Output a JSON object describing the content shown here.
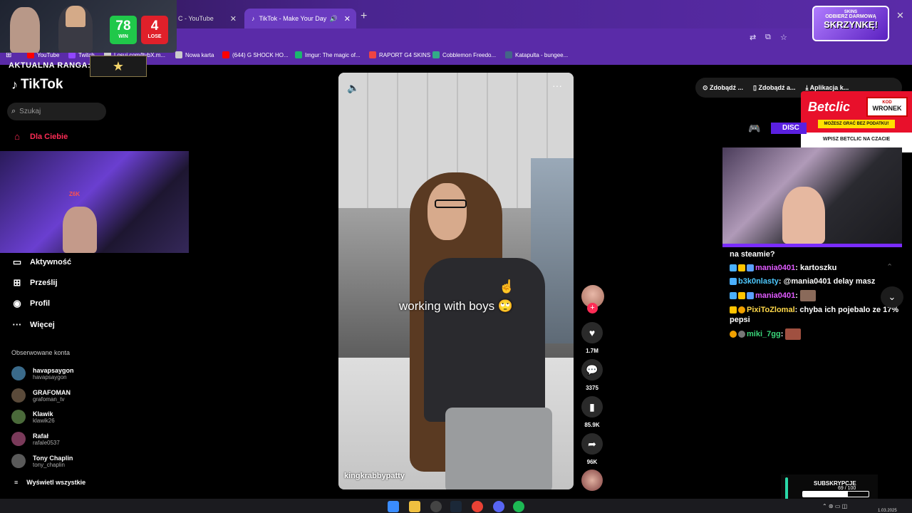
{
  "browser": {
    "tabs": [
      {
        "label": "C - YouTube"
      },
      {
        "label": "TikTok - Make Your Day"
      }
    ],
    "new_tab": "+",
    "close": "✕",
    "bookmarks": [
      {
        "label": "YouTube",
        "color": "#ff0000"
      },
      {
        "label": "Twitch",
        "color": "#9146ff"
      },
      {
        "label": "Losuj.com/ltybX.m...",
        "color": "#cccccc"
      },
      {
        "label": "Nowa karta",
        "color": "#cccccc"
      },
      {
        "label": "(644) G SHOCK HO...",
        "color": "#ff0000"
      },
      {
        "label": "Imgur: The magic of...",
        "color": "#1bb76e"
      },
      {
        "label": "RAPORT G4 SKINS",
        "color": "#e44"
      },
      {
        "label": "Cobblemon Freedo...",
        "color": "#3a8"
      },
      {
        "label": "Katapulta - bungee...",
        "color": "#468"
      }
    ]
  },
  "stream_overlay": {
    "score_win": "78",
    "score_win_label": "WIN",
    "score_lose": "4",
    "score_lose_label": "LOSE",
    "rank_label": "AKTUALNA RANGA:",
    "rank_icon": "star-badge-icon",
    "promo_line1": "ODBIERZ DARMOWĄ",
    "promo_line2": "SKRZYNKĘ!",
    "promo_brand": "SKINS",
    "cam_tag": "Z6K"
  },
  "sidebar": {
    "logo": "TikTok",
    "search_placeholder": "Szukaj",
    "nav": [
      {
        "label": "Dla Ciebie",
        "icon": "home-icon",
        "active": true
      },
      {
        "label": "Aktywność",
        "icon": "activity-icon"
      },
      {
        "label": "Prześlij",
        "icon": "upload-icon"
      },
      {
        "label": "Profil",
        "icon": "profile-icon"
      },
      {
        "label": "Więcej",
        "icon": "more-icon"
      }
    ],
    "following_header": "Obserwowane konta",
    "following": [
      {
        "name": "havapsaygon",
        "handle": "havapsaygon",
        "color": "#3a6a8a"
      },
      {
        "name": "GRAFOMAN",
        "handle": "grafoman_tv",
        "color": "#5a4a3a"
      },
      {
        "name": "Klawik",
        "handle": "klawik26",
        "color": "#4a6a3a"
      },
      {
        "name": "Rafał",
        "handle": "rafale0537",
        "color": "#7a3a5a"
      },
      {
        "name": "Tony Chaplin",
        "handle": "tony_chaplin",
        "color": "#5a5a5a"
      }
    ],
    "see_all": "Wyświetl wszystkie"
  },
  "video": {
    "caption": "working with boys 🙄",
    "username": "kingkrabbypatty",
    "actions": [
      {
        "icon": "heart-icon",
        "count": "1.7M"
      },
      {
        "icon": "comment-icon",
        "count": "3375"
      },
      {
        "icon": "bookmark-icon",
        "count": "85.9K"
      },
      {
        "icon": "share-icon",
        "count": "96K"
      }
    ]
  },
  "header_right": {
    "items": [
      {
        "label": "Zdobądź ...",
        "icon": "coin-icon"
      },
      {
        "label": "Zdobądź a...",
        "icon": "phone-icon"
      },
      {
        "label": "Aplikacja k...",
        "icon": "download-icon"
      }
    ]
  },
  "betclic": {
    "brand": "Betclic",
    "code_label": "KOD",
    "code": "WRONEK",
    "strip": "MOŻESZ GRAĆ BEZ PODATKU!",
    "footer": "WPISZ  BETCLIC  NA CZACIE"
  },
  "discord": {
    "label": "DISC"
  },
  "chat": [
    {
      "user": "",
      "user_color": "#ffffff",
      "text": "na steamie?",
      "badges": 0
    },
    {
      "user": "mania0401",
      "user_color": "#e05aff",
      "text": ": kartoszku",
      "badges": 3
    },
    {
      "user": "b3k0nlasty",
      "user_color": "#4ec9ff",
      "text": ": @mania0401 delay masz",
      "badges": 1
    },
    {
      "user": "mania0401",
      "user_color": "#e05aff",
      "text": ":",
      "badges": 3,
      "emote": true
    },
    {
      "user": "PixiToZlomal",
      "user_color": "#ffd94a",
      "text": ": chyba ich pojebalo ze 17% pepsi",
      "badges": 2
    },
    {
      "user": "miki_7gg",
      "user_color": "#3ad67a",
      "text": ":",
      "badges": 2,
      "emote": true
    }
  ],
  "subs": {
    "label": "SUBSKRYPCJE",
    "count": "69 / 100",
    "progress_fraction": 0.69
  },
  "taskbar": {
    "clock": "1.03.2025"
  }
}
